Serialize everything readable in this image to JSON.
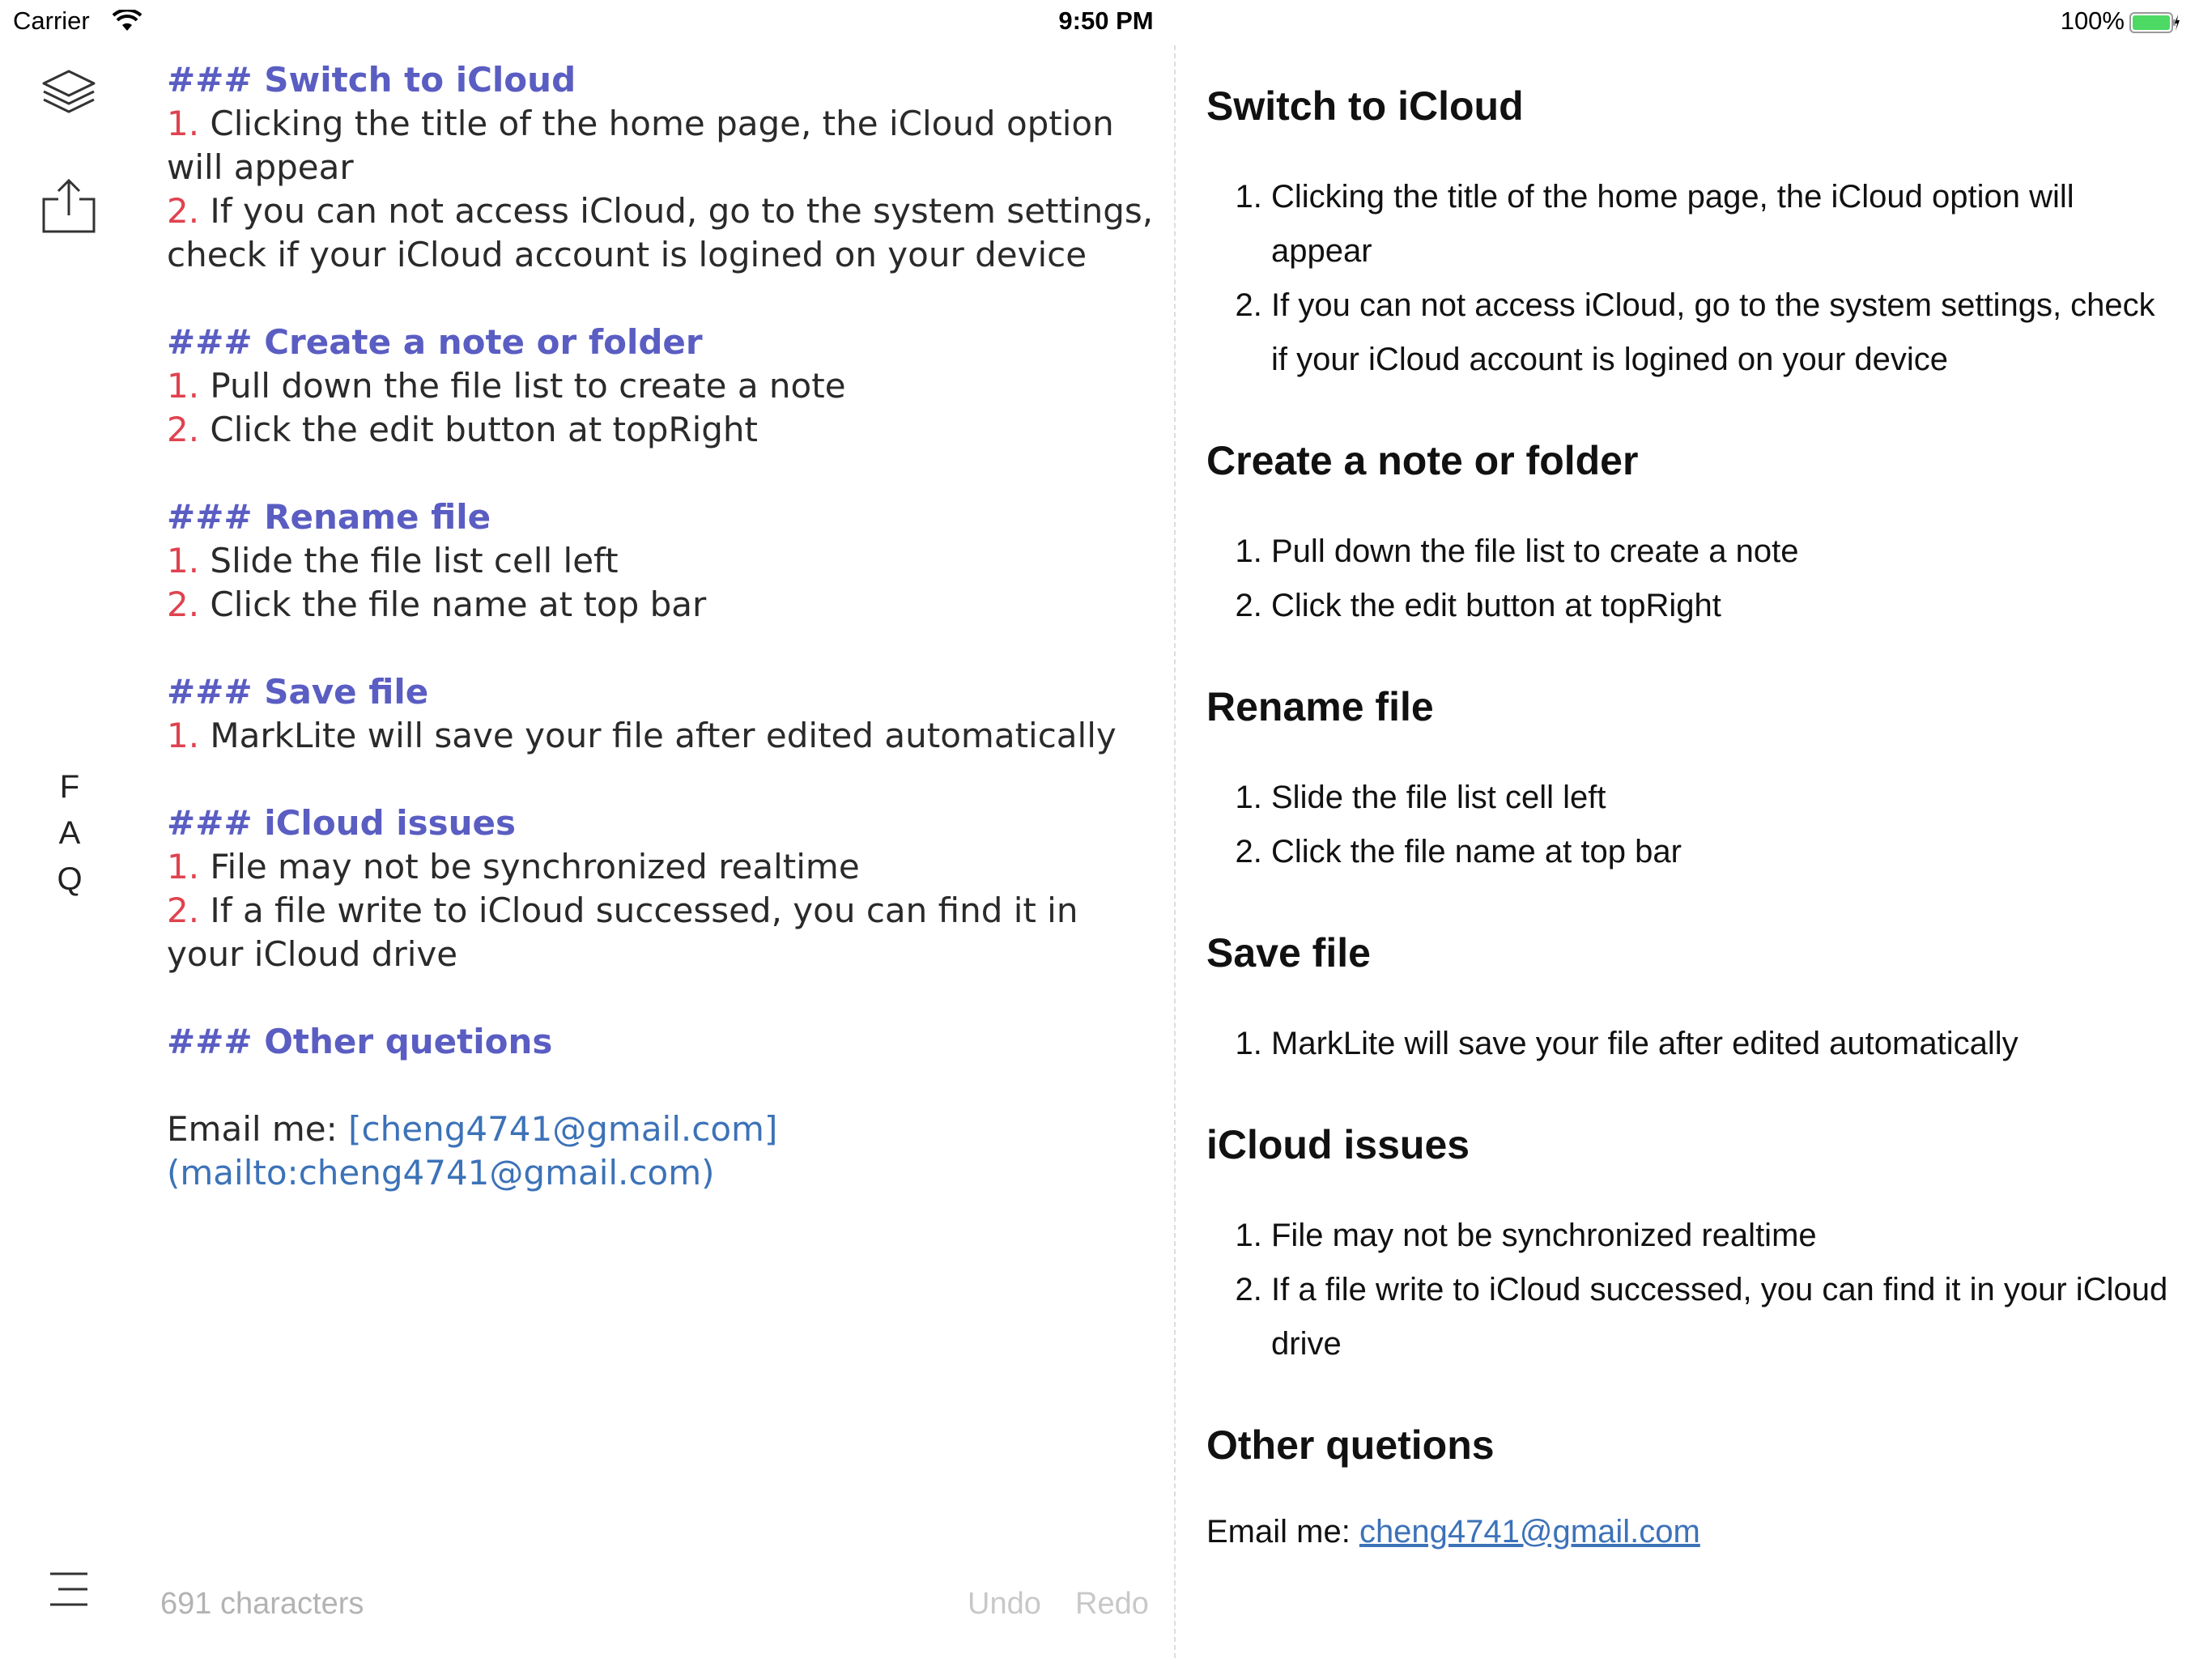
{
  "status": {
    "carrier": "Carrier",
    "time": "9:50 PM",
    "battery": "100%"
  },
  "sidebar": {
    "icons": [
      "layers-icon",
      "share-icon",
      "menu-icon"
    ],
    "faq": [
      "F",
      "A",
      "Q"
    ]
  },
  "editor": {
    "sections": [
      {
        "heading": "### Switch to iCloud",
        "items": [
          {
            "num": "1.",
            "text": " Clicking the title of the home page, the iCloud option will appear"
          },
          {
            "num": "2.",
            "text": " If you can not access iCloud, go to the system settings, check if your iCloud account is logined on your device"
          }
        ]
      },
      {
        "heading": "### Create a note or folder",
        "items": [
          {
            "num": "1.",
            "text": " Pull down the file list to create a note"
          },
          {
            "num": "2.",
            "text": " Click the edit button at topRight"
          }
        ]
      },
      {
        "heading": "### Rename file",
        "items": [
          {
            "num": "1.",
            "text": " Slide the file list cell left"
          },
          {
            "num": "2.",
            "text": " Click the file name at top bar"
          }
        ]
      },
      {
        "heading": "### Save file",
        "items": [
          {
            "num": "1.",
            "text": " MarkLite will save your file after edited automatically"
          }
        ]
      },
      {
        "heading": "### iCloud issues",
        "items": [
          {
            "num": "1.",
            "text": " File may not be synchronized realtime"
          },
          {
            "num": "2.",
            "text": " If a file write to iCloud successed, you can find it in your iCloud drive"
          }
        ]
      },
      {
        "heading": "### Other quetions",
        "items": []
      }
    ],
    "email_prefix": "Email me: ",
    "email_markdown": "[cheng4741@gmail.com](mailto:cheng4741@gmail.com)"
  },
  "bottom_bar": {
    "char_count": "691 characters",
    "undo": "Undo",
    "redo": "Redo"
  },
  "preview": {
    "sections": [
      {
        "heading": "Switch to iCloud",
        "items": [
          "Clicking the title of the home page, the iCloud option will appear",
          "If you can not access iCloud, go to the system settings, check if your iCloud account is logined on your device"
        ]
      },
      {
        "heading": "Create a note or folder",
        "items": [
          "Pull down the file list to create a note",
          "Click the edit button at topRight"
        ]
      },
      {
        "heading": "Rename file",
        "items": [
          "Slide the file list cell left",
          "Click the file name at top bar"
        ]
      },
      {
        "heading": "Save file",
        "items": [
          "MarkLite will save your file after edited automatically"
        ]
      },
      {
        "heading": "iCloud issues",
        "items": [
          "File may not be synchronized realtime",
          "If a file write to iCloud successed, you can find it in your iCloud drive"
        ]
      },
      {
        "heading": "Other quetions",
        "items": []
      }
    ],
    "email_prefix": "Email me: ",
    "email_link": "cheng4741@gmail.com"
  },
  "colors": {
    "heading": "#5a5dc2",
    "list_number": "#e0424f",
    "link": "#3c72b8",
    "battery": "#4cd964"
  }
}
